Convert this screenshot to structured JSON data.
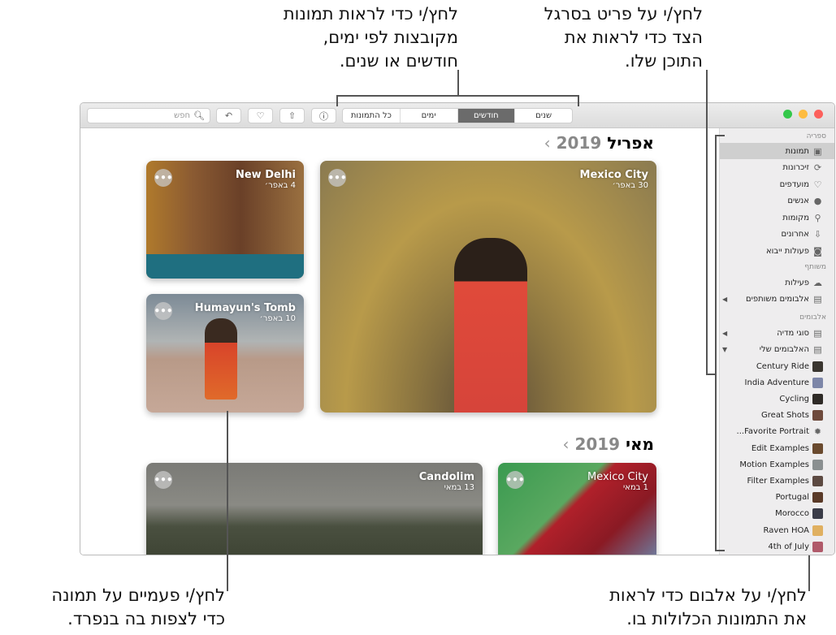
{
  "callouts": {
    "top_middle": [
      "לחץ/י כדי לראות תמונות",
      "מקובצות לפי ימים,",
      "חודשים או שנים."
    ],
    "top_right": [
      "לחץ/י על פריט בסרגל",
      "הצד כדי לראות את",
      "התוכן שלו."
    ],
    "bottom_left": [
      "לחץ/י פעמיים על תמונה",
      "כדי לצפות בה בנפרד."
    ],
    "bottom_right": [
      "לחץ/י על אלבום כדי לראות",
      "את התמונות הכלולות בו."
    ]
  },
  "toolbar": {
    "search_placeholder": "חפש",
    "view_tabs": [
      {
        "label": "שנים"
      },
      {
        "label": "חודשים",
        "selected": true
      },
      {
        "label": "ימים"
      },
      {
        "label": "כל התמונות"
      }
    ],
    "buttons": [
      "info-icon",
      "share-icon",
      "heart-icon",
      "rotate-icon"
    ]
  },
  "sidebar": {
    "library_header": "ספריה",
    "library": [
      {
        "label": "תמונות",
        "icon": "photos-icon",
        "selected": true
      },
      {
        "label": "זיכרונות",
        "icon": "memories-icon"
      },
      {
        "label": "מועדפים",
        "icon": "heart-icon"
      },
      {
        "label": "אנשים",
        "icon": "person-icon"
      },
      {
        "label": "מקומות",
        "icon": "pin-icon"
      },
      {
        "label": "אחרונים",
        "icon": "import-icon"
      },
      {
        "label": "פעולות ייבוא",
        "icon": "camera-icon"
      }
    ],
    "shared_header": "משותף",
    "shared": [
      {
        "label": "פעילות",
        "icon": "cloud-icon"
      },
      {
        "label": "אלבומים משותפים",
        "icon": "folder-icon",
        "disclosure": "collapsed"
      }
    ],
    "albums_header": "אלבומים",
    "album_groups": [
      {
        "label": "סוגי מדיה",
        "icon": "folder-icon",
        "disclosure": "collapsed"
      },
      {
        "label": "האלבומים שלי",
        "icon": "folder-icon",
        "disclosure": "expanded"
      }
    ],
    "albums": [
      {
        "label": "Century Ride",
        "color": "#3a3630"
      },
      {
        "label": "India Adventure",
        "color": "#7d86a8"
      },
      {
        "label": "Cycling",
        "color": "#2e2a26"
      },
      {
        "label": "Great Shots",
        "color": "#6e4a3c"
      },
      {
        "label": "Favorite Portrait...",
        "color": "#cccccc",
        "icon": "gear-icon"
      },
      {
        "label": "Edit Examples",
        "color": "#6a4a2e"
      },
      {
        "label": "Motion Examples",
        "color": "#8a8f90"
      },
      {
        "label": "Filter Examples",
        "color": "#5d4a42"
      },
      {
        "label": "Portugal",
        "color": "#5a3a28"
      },
      {
        "label": "Morocco",
        "color": "#3a3c48"
      },
      {
        "label": "Raven HOA",
        "color": "#e0b060"
      },
      {
        "label": "4th of July",
        "color": "#b05a6a"
      }
    ]
  },
  "sections": [
    {
      "month": "אפריל",
      "year": "2019",
      "cards": [
        {
          "title": "Mexico City",
          "date": "30 באפר׳"
        },
        {
          "title": "New Delhi",
          "date": "4 באפר׳"
        },
        {
          "title": "Humayun's Tomb",
          "date": "10 באפר׳"
        }
      ]
    },
    {
      "month": "מאי",
      "year": "2019",
      "cards": [
        {
          "title": "Mexico City",
          "date": "1 במאי"
        },
        {
          "title": "Candolim",
          "date": "13 במאי"
        }
      ]
    }
  ],
  "more_label": "•••",
  "colors": {
    "selected_tab": "#6b6b6b",
    "close": "#fc605c",
    "minimize": "#fdbc40",
    "zoom": "#34c84a"
  }
}
